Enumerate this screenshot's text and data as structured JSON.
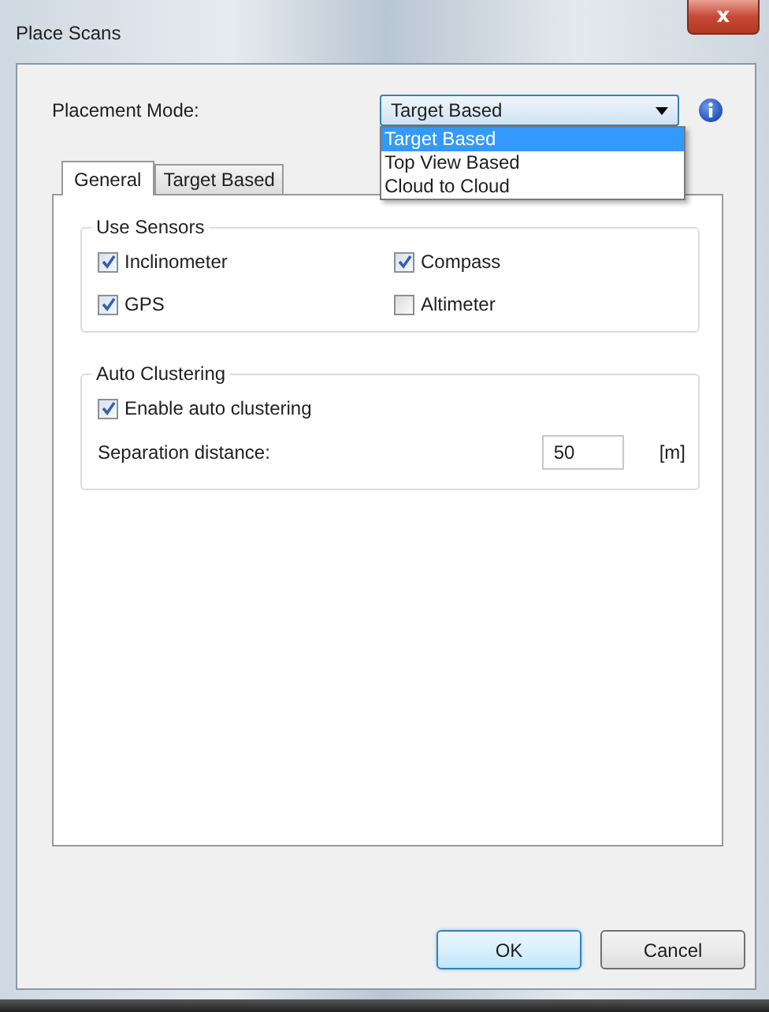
{
  "window": {
    "title": "Place Scans",
    "close_glyph": "x"
  },
  "placement": {
    "label": "Placement Mode:",
    "value": "Target Based",
    "open": true,
    "options": [
      {
        "label": "Target Based",
        "selected": true
      },
      {
        "label": "Top View Based",
        "selected": false
      },
      {
        "label": "Cloud to Cloud",
        "selected": false
      }
    ]
  },
  "tabs": [
    {
      "label": "General",
      "selected": true
    },
    {
      "label": "Target Based",
      "selected": false
    }
  ],
  "sensors": {
    "title": "Use Sensors",
    "items": [
      {
        "label": "Inclinometer",
        "checked": true
      },
      {
        "label": "Compass",
        "checked": true
      },
      {
        "label": "GPS",
        "checked": true
      },
      {
        "label": "Altimeter",
        "checked": false
      }
    ]
  },
  "clustering": {
    "title": "Auto Clustering",
    "enable": {
      "label": "Enable auto clustering",
      "checked": true
    },
    "distance_label": "Separation distance:",
    "distance_value": "50",
    "unit": "[m]"
  },
  "buttons": [
    {
      "label": "OK",
      "default": true
    },
    {
      "label": "Cancel",
      "default": false
    }
  ]
}
